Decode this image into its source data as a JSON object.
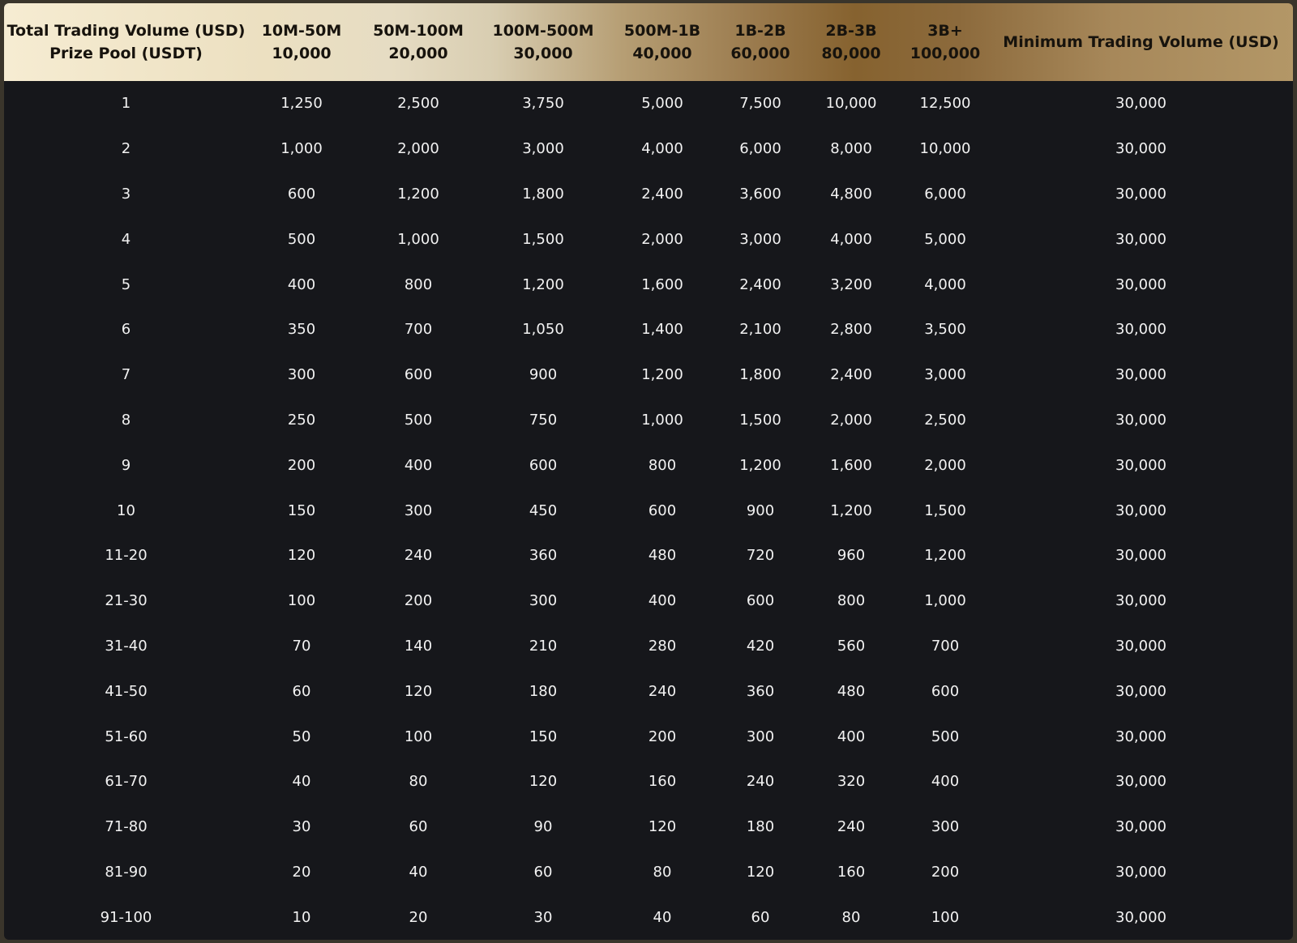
{
  "header": {
    "first_col": {
      "line1": "Total Trading Volume (USD)",
      "line2": "Prize Pool (USDT)"
    },
    "tiers": [
      {
        "range": "10M-50M",
        "pool": "10,000"
      },
      {
        "range": "50M-100M",
        "pool": "20,000"
      },
      {
        "range": "100M-500M",
        "pool": "30,000"
      },
      {
        "range": "500M-1B",
        "pool": "40,000"
      },
      {
        "range": "1B-2B",
        "pool": "60,000"
      },
      {
        "range": "2B-3B",
        "pool": "80,000"
      },
      {
        "range": "3B+",
        "pool": "100,000"
      }
    ],
    "last_col": "Minimum Trading Volume (USD)"
  },
  "rows": [
    {
      "rank": "1",
      "prizes": [
        "1,250",
        "2,500",
        "3,750",
        "5,000",
        "7,500",
        "10,000",
        "12,500"
      ],
      "min_volume": "30,000"
    },
    {
      "rank": "2",
      "prizes": [
        "1,000",
        "2,000",
        "3,000",
        "4,000",
        "6,000",
        "8,000",
        "10,000"
      ],
      "min_volume": "30,000"
    },
    {
      "rank": "3",
      "prizes": [
        "600",
        "1,200",
        "1,800",
        "2,400",
        "3,600",
        "4,800",
        "6,000"
      ],
      "min_volume": "30,000"
    },
    {
      "rank": "4",
      "prizes": [
        "500",
        "1,000",
        "1,500",
        "2,000",
        "3,000",
        "4,000",
        "5,000"
      ],
      "min_volume": "30,000"
    },
    {
      "rank": "5",
      "prizes": [
        "400",
        "800",
        "1,200",
        "1,600",
        "2,400",
        "3,200",
        "4,000"
      ],
      "min_volume": "30,000"
    },
    {
      "rank": "6",
      "prizes": [
        "350",
        "700",
        "1,050",
        "1,400",
        "2,100",
        "2,800",
        "3,500"
      ],
      "min_volume": "30,000"
    },
    {
      "rank": "7",
      "prizes": [
        "300",
        "600",
        "900",
        "1,200",
        "1,800",
        "2,400",
        "3,000"
      ],
      "min_volume": "30,000"
    },
    {
      "rank": "8",
      "prizes": [
        "250",
        "500",
        "750",
        "1,000",
        "1,500",
        "2,000",
        "2,500"
      ],
      "min_volume": "30,000"
    },
    {
      "rank": "9",
      "prizes": [
        "200",
        "400",
        "600",
        "800",
        "1,200",
        "1,600",
        "2,000"
      ],
      "min_volume": "30,000"
    },
    {
      "rank": "10",
      "prizes": [
        "150",
        "300",
        "450",
        "600",
        "900",
        "1,200",
        "1,500"
      ],
      "min_volume": "30,000"
    },
    {
      "rank": "11-20",
      "prizes": [
        "120",
        "240",
        "360",
        "480",
        "720",
        "960",
        "1,200"
      ],
      "min_volume": "30,000"
    },
    {
      "rank": "21-30",
      "prizes": [
        "100",
        "200",
        "300",
        "400",
        "600",
        "800",
        "1,000"
      ],
      "min_volume": "30,000"
    },
    {
      "rank": "31-40",
      "prizes": [
        "70",
        "140",
        "210",
        "280",
        "420",
        "560",
        "700"
      ],
      "min_volume": "30,000"
    },
    {
      "rank": "41-50",
      "prizes": [
        "60",
        "120",
        "180",
        "240",
        "360",
        "480",
        "600"
      ],
      "min_volume": "30,000"
    },
    {
      "rank": "51-60",
      "prizes": [
        "50",
        "100",
        "150",
        "200",
        "300",
        "400",
        "500"
      ],
      "min_volume": "30,000"
    },
    {
      "rank": "61-70",
      "prizes": [
        "40",
        "80",
        "120",
        "160",
        "240",
        "320",
        "400"
      ],
      "min_volume": "30,000"
    },
    {
      "rank": "71-80",
      "prizes": [
        "30",
        "60",
        "90",
        "120",
        "180",
        "240",
        "300"
      ],
      "min_volume": "30,000"
    },
    {
      "rank": "81-90",
      "prizes": [
        "20",
        "40",
        "60",
        "80",
        "120",
        "160",
        "200"
      ],
      "min_volume": "30,000"
    },
    {
      "rank": "91-100",
      "prizes": [
        "10",
        "20",
        "30",
        "40",
        "60",
        "80",
        "100"
      ],
      "min_volume": "30,000"
    }
  ],
  "colors": {
    "header_gradient": [
      "#f6ecd2",
      "#e6dcc3",
      "#86622f",
      "#b39767"
    ],
    "header_text": "#17130d",
    "body_background": "#16171b",
    "body_text": "#f2f2f2",
    "frame": "#3a352b"
  }
}
